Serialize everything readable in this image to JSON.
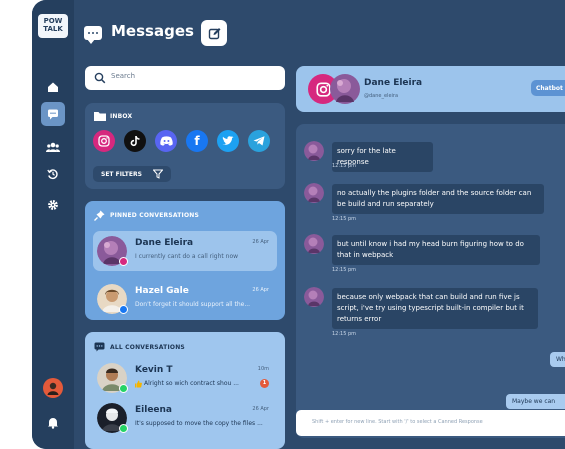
{
  "app": {
    "logo_line1": "POW",
    "logo_line2": "TALK",
    "title": "Messages"
  },
  "colors": {
    "rail": "#253f5e",
    "panel": "#2e4a6c",
    "card": "#3b5a80",
    "accent": "#6ea4de",
    "light": "#9fc6ee",
    "alert": "#e45a3a"
  },
  "rail_icons": [
    "home-icon",
    "messages-icon",
    "users-icon",
    "history-icon",
    "settings-icon",
    "profile-avatar",
    "bell-icon"
  ],
  "search": {
    "placeholder": "Search"
  },
  "inbox": {
    "label": "INBOX",
    "channels": [
      "instagram-icon",
      "tiktok-icon",
      "discord-icon",
      "facebook-icon",
      "twitter-icon",
      "telegram-icon"
    ],
    "set_filters": "SET FILTERS"
  },
  "pinned": {
    "label": "PINNED CONVERSATIONS",
    "items": [
      {
        "name": "Dane Eleira",
        "time": "26 Apr",
        "preview": "I currently cant do a call right now"
      },
      {
        "name": "Hazel Gale",
        "time": "26 Apr",
        "preview": "Don't forget it should support all the..."
      }
    ]
  },
  "all": {
    "label": "ALL CONVERSATIONS",
    "items": [
      {
        "name": "Kevin T",
        "time": "10m",
        "preview": "Alright so wich contract shou ...",
        "unread": "1"
      },
      {
        "name": "Eileena",
        "time": "26 Apr",
        "preview": "It's supposed to move the copy the files ..."
      }
    ]
  },
  "chat": {
    "contact_name": "Dane Eleira",
    "contact_handle": "@dane_eleira",
    "chatbot_label": "Chatbot E",
    "messages": [
      {
        "text": "sorry for the late response",
        "time": "12:15 pm"
      },
      {
        "text": "no actually the plugins folder and the source folder can be build and run separately",
        "time": "12:15 pm"
      },
      {
        "text": "but until know i had my head burn figuring how to do that in webpack",
        "time": "12:15 pm"
      },
      {
        "text": "because only webpack that can build and run five js script, i've try using typescript built-in compiler but it returns error",
        "time": "12:15 pm"
      }
    ],
    "outgoing": [
      "Wh",
      "Maybe we can"
    ],
    "composer_placeholder": "Shift + enter for new line. Start with '/' to select a Canned Response"
  }
}
